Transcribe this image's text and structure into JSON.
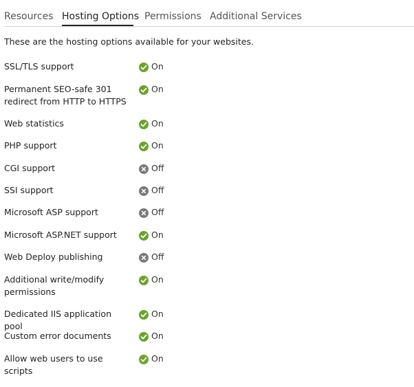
{
  "tabs": [
    {
      "label": "Resources",
      "active": false
    },
    {
      "label": "Hosting Options",
      "active": true
    },
    {
      "label": "Permissions",
      "active": false
    },
    {
      "label": "Additional Services",
      "active": false
    }
  ],
  "intro": "These are the hosting options available for your websites.",
  "colors": {
    "on": "#6ba32b",
    "off": "#7a7a7a"
  },
  "options": [
    {
      "label": "SSL/TLS support",
      "status": "On",
      "state": "on"
    },
    {
      "label": "Permanent SEO-safe 301 redirect from HTTP to HTTPS",
      "status": "On",
      "state": "on"
    },
    {
      "label": "Web statistics",
      "status": "On",
      "state": "on"
    },
    {
      "label": "PHP support",
      "status": "On",
      "state": "on"
    },
    {
      "label": "CGI support",
      "status": "Off",
      "state": "off"
    },
    {
      "label": "SSI support",
      "status": "Off",
      "state": "off"
    },
    {
      "label": "Microsoft ASP support",
      "status": "Off",
      "state": "off"
    },
    {
      "label": "Microsoft ASP.NET support",
      "status": "On",
      "state": "on"
    },
    {
      "label": "Web Deploy publishing",
      "status": "Off",
      "state": "off"
    },
    {
      "label": "Additional write/modify permissions",
      "status": "On",
      "state": "on"
    },
    {
      "label": "Dedicated IIS application pool",
      "status": "On",
      "state": "on"
    },
    {
      "label": "Custom error documents",
      "status": "On",
      "state": "on"
    },
    {
      "label": "Allow web users to use scripts",
      "status": "On",
      "state": "on"
    }
  ]
}
